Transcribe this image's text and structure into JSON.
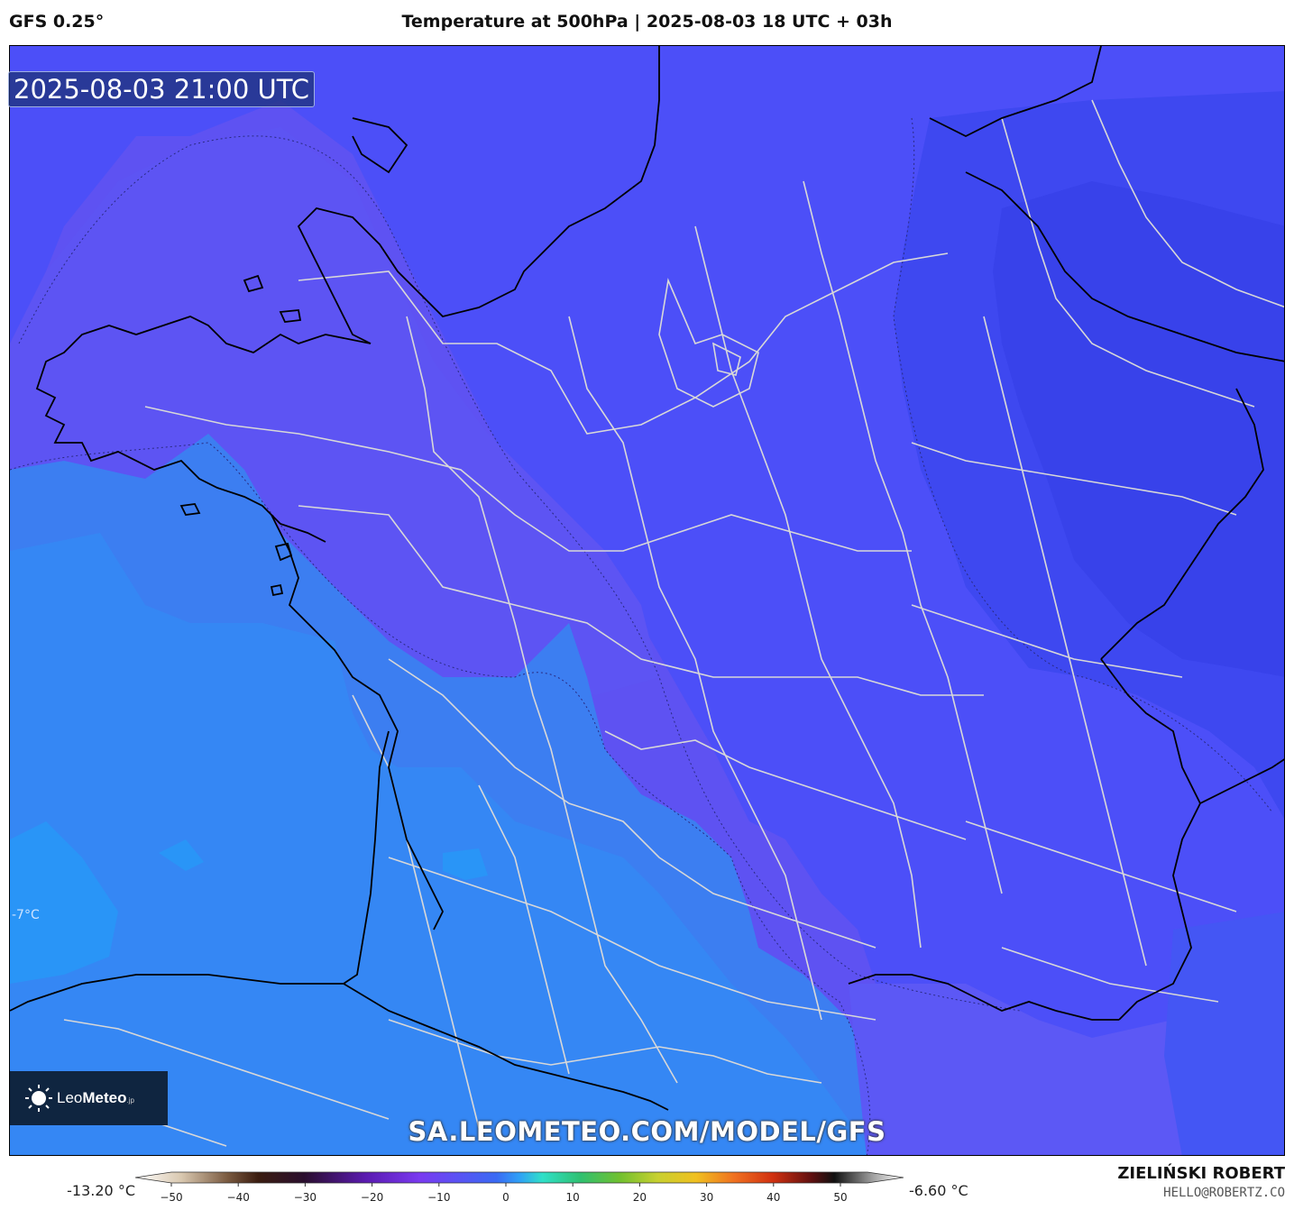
{
  "header": {
    "model": "GFS 0.25°",
    "title": "Temperature at 500hPa | 2025-08-03 18 UTC + 03h"
  },
  "map": {
    "valid_time": "2025-08-03 21:00 UTC",
    "contour_label": "-7°C",
    "watermark": "SA.LEOMETEO.COM/MODEL/GFS",
    "colors": {
      "violet": "#5e52f2",
      "blue": "#4a4ef8",
      "dark_blue": "#3c44ee",
      "sea_blue": "#3b7ff0",
      "light_blue": "#2f8cf5",
      "border_line": "#d8d8d8",
      "coast_line": "#000000"
    }
  },
  "logo": {
    "name_light": "Leo",
    "name_bold": "Meteo",
    "suffix": ".jp"
  },
  "legend": {
    "min_label": "-13.20 °C",
    "max_label": "-6.60 °C",
    "ticks": [
      "−50",
      "−40",
      "−30",
      "−20",
      "−10",
      "0",
      "10",
      "20",
      "30",
      "40",
      "50"
    ]
  },
  "credit": {
    "name": "ZIELIŃSKI ROBERT",
    "email": "HELLO@ROBERTZ.CO"
  }
}
